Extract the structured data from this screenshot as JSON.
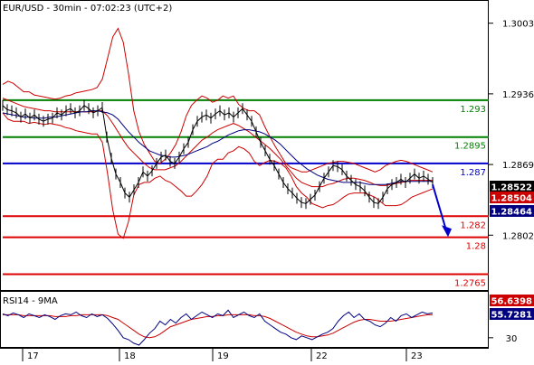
{
  "chart_data": {
    "type": "line",
    "title": "EUR/USD - 30min - 07:02:23 (UTC+2)",
    "xlabel": "",
    "ylabel": "",
    "x_ticks": [
      "17",
      "18",
      "19",
      "22",
      "23"
    ],
    "ylim": [
      1.275,
      1.3025
    ],
    "y_ticks": [
      "1.3003",
      "1.2936",
      "1.2869",
      "1.2802"
    ],
    "legend": "none",
    "grid": false,
    "price": {
      "name": "EUR/USD",
      "color": "#000000",
      "values": [
        1.2925,
        1.2921,
        1.292,
        1.2918,
        1.2914,
        1.2917,
        1.2913,
        1.2916,
        1.2912,
        1.291,
        1.2912,
        1.2913,
        1.2918,
        1.2916,
        1.292,
        1.2922,
        1.2918,
        1.292,
        1.2925,
        1.2922,
        1.2918,
        1.292,
        1.2923,
        1.2895,
        1.2875,
        1.286,
        1.2852,
        1.2842,
        1.2838,
        1.2845,
        1.2852,
        1.2862,
        1.2858,
        1.2863,
        1.287,
        1.2876,
        1.2878,
        1.2872,
        1.287,
        1.2876,
        1.2884,
        1.289,
        1.2902,
        1.291,
        1.2914,
        1.2916,
        1.2913,
        1.2917,
        1.292,
        1.2916,
        1.2918,
        1.2914,
        1.2918,
        1.2922,
        1.2916,
        1.291,
        1.29,
        1.289,
        1.2882,
        1.2874,
        1.2868,
        1.286,
        1.2852,
        1.2846,
        1.2842,
        1.2837,
        1.2833,
        1.2832,
        1.2836,
        1.284,
        1.2848,
        1.2856,
        1.2862,
        1.2868,
        1.2867,
        1.2864,
        1.2858,
        1.2854,
        1.285,
        1.2848,
        1.2844,
        1.2838,
        1.2833,
        1.2832,
        1.2838,
        1.2846,
        1.285,
        1.2852,
        1.2855,
        1.2852,
        1.2856,
        1.286,
        1.2856,
        1.2858,
        1.2855,
        1.2852
      ]
    },
    "bollinger": {
      "name": "Bollinger Bands",
      "color": "#cc0000",
      "upper": [
        1.2945,
        1.2948,
        1.2946,
        1.2942,
        1.2938,
        1.2938,
        1.2935,
        1.2934,
        1.2933,
        1.2932,
        1.2931,
        1.2932,
        1.2934,
        1.2935,
        1.2937,
        1.2938,
        1.2939,
        1.294,
        1.2942,
        1.295,
        1.297,
        1.299,
        1.2998,
        1.2985,
        1.2955,
        1.292,
        1.29,
        1.2888,
        1.288,
        1.2872,
        1.287,
        1.2874,
        1.288,
        1.2888,
        1.29,
        1.2915,
        1.2925,
        1.293,
        1.2934,
        1.2932,
        1.2928,
        1.293,
        1.2934,
        1.2932,
        1.2934,
        1.2926,
        1.2922,
        1.292,
        1.292,
        1.2916,
        1.2905,
        1.2895,
        1.2886,
        1.2878,
        1.287,
        1.2866,
        1.2864,
        1.2862,
        1.2862,
        1.2864,
        1.2866,
        1.2868,
        1.287,
        1.2871,
        1.2872,
        1.2872,
        1.2871,
        1.287,
        1.2868,
        1.2866,
        1.2864,
        1.2862,
        1.2864,
        1.2868,
        1.287,
        1.2872,
        1.2873,
        1.2872,
        1.287,
        1.2868,
        1.2866,
        1.2864,
        1.2862
      ],
      "middle": [
        1.2932,
        1.293,
        1.2928,
        1.2926,
        1.2924,
        1.2923,
        1.2922,
        1.2921,
        1.292,
        1.292,
        1.2919,
        1.2919,
        1.2919,
        1.2919,
        1.2919,
        1.2919,
        1.2919,
        1.2919,
        1.292,
        1.292,
        1.2915,
        1.2908,
        1.29,
        1.2892,
        1.2885,
        1.288,
        1.2875,
        1.287,
        1.2866,
        1.2864,
        1.2864,
        1.2864,
        1.2866,
        1.2868,
        1.2872,
        1.2877,
        1.2882,
        1.2887,
        1.2892,
        1.2895,
        1.2899,
        1.2902,
        1.2904,
        1.2906,
        1.2908,
        1.2906,
        1.2903,
        1.29,
        1.2896,
        1.2892,
        1.2888,
        1.2884,
        1.2879,
        1.2874,
        1.2868,
        1.2862,
        1.2856,
        1.2852,
        1.285,
        1.2848,
        1.2848,
        1.2848,
        1.285,
        1.2851,
        1.2853,
        1.2855,
        1.2856,
        1.2856,
        1.2855,
        1.2854,
        1.2852,
        1.285,
        1.2849,
        1.2849,
        1.285,
        1.2851,
        1.2852,
        1.2853,
        1.2854,
        1.2854,
        1.2854,
        1.2854,
        1.2854
      ],
      "lower": [
        1.2918,
        1.2912,
        1.291,
        1.291,
        1.291,
        1.2908,
        1.2909,
        1.2908,
        1.2907,
        1.2908,
        1.2907,
        1.2906,
        1.2904,
        1.2903,
        1.2901,
        1.29,
        1.2899,
        1.2898,
        1.2898,
        1.289,
        1.286,
        1.2826,
        1.2803,
        1.2799,
        1.2815,
        1.284,
        1.285,
        1.2852,
        1.2852,
        1.2856,
        1.2858,
        1.2854,
        1.2852,
        1.2848,
        1.2844,
        1.2839,
        1.2839,
        1.2844,
        1.285,
        1.2858,
        1.287,
        1.2874,
        1.2874,
        1.288,
        1.2882,
        1.2886,
        1.2884,
        1.288,
        1.2872,
        1.2868,
        1.2871,
        1.2873,
        1.2872,
        1.287,
        1.2866,
        1.2858,
        1.2848,
        1.2842,
        1.2838,
        1.2832,
        1.283,
        1.2828,
        1.283,
        1.2831,
        1.2834,
        1.2838,
        1.2841,
        1.2842,
        1.2842,
        1.2842,
        1.284,
        1.2838,
        1.2834,
        1.283,
        1.283,
        1.283,
        1.2831,
        1.2834,
        1.2838,
        1.284,
        1.2842,
        1.2844,
        1.2846
      ]
    },
    "moving_average": {
      "name": "Moving Average",
      "color": "#000080",
      "values": [
        1.2918,
        1.2917,
        1.2916,
        1.2915,
        1.2914,
        1.2914,
        1.2913,
        1.2913,
        1.2913,
        1.2914,
        1.2914,
        1.2915,
        1.2916,
        1.2917,
        1.2918,
        1.2919,
        1.2919,
        1.292,
        1.292,
        1.2919,
        1.2918,
        1.2916,
        1.2912,
        1.2906,
        1.29,
        1.2895,
        1.289,
        1.2886,
        1.2882,
        1.288,
        1.2878,
        1.2877,
        1.2876,
        1.2876,
        1.2877,
        1.2878,
        1.288,
        1.2882,
        1.2884,
        1.2886,
        1.2889,
        1.2891,
        1.2894,
        1.2897,
        1.2899,
        1.2901,
        1.2902,
        1.2902,
        1.2901,
        1.29,
        1.2898,
        1.2895,
        1.2892,
        1.2888,
        1.2883,
        1.2878,
        1.2873,
        1.2869,
        1.2865,
        1.2862,
        1.2859,
        1.2857,
        1.2855,
        1.2854,
        1.2853,
        1.2852,
        1.2852,
        1.2852,
        1.2852,
        1.2851,
        1.285,
        1.285,
        1.285,
        1.285,
        1.2851,
        1.2852,
        1.2853,
        1.2853,
        1.2853,
        1.2853,
        1.2853,
        1.2853,
        1.2853
      ]
    },
    "levels": [
      {
        "value": 1.293,
        "label": "1.293",
        "color": "#008000"
      },
      {
        "value": 1.2895,
        "label": "1.2895",
        "color": "#008000"
      },
      {
        "value": 1.287,
        "label": "1.287",
        "color": "#0000cc"
      },
      {
        "value": 1.282,
        "label": "1.282",
        "color": "#dd0000"
      },
      {
        "value": 1.28,
        "label": "1.28",
        "color": "#dd0000"
      },
      {
        "value": 1.2765,
        "label": "1.2765",
        "color": "#dd0000"
      }
    ],
    "price_badges": [
      {
        "label": "1.28522",
        "color": "#000000"
      },
      {
        "label": "1.28504",
        "color": "#cc0000"
      },
      {
        "label": "1.28464",
        "color": "#000080"
      }
    ],
    "forecast_arrow": {
      "from": 1.285,
      "to": 1.2802,
      "color": "#0000cc"
    },
    "rsi": {
      "title": "RSI14 - 9MA",
      "ylim": [
        20,
        80
      ],
      "y_ticks": [
        "30"
      ],
      "rsi_values": [
        56,
        54,
        57,
        55,
        52,
        56,
        54,
        52,
        55,
        53,
        50,
        54,
        56,
        55,
        58,
        54,
        52,
        56,
        53,
        55,
        51,
        45,
        38,
        30,
        28,
        24,
        22,
        28,
        35,
        40,
        48,
        44,
        50,
        46,
        52,
        56,
        50,
        54,
        58,
        55,
        52,
        56,
        54,
        60,
        52,
        55,
        58,
        54,
        52,
        56,
        48,
        44,
        40,
        36,
        34,
        30,
        28,
        32,
        30,
        28,
        31,
        34,
        36,
        40,
        48,
        54,
        58,
        52,
        56,
        50,
        48,
        44,
        42,
        46,
        52,
        48,
        54,
        56,
        52,
        55,
        58,
        56,
        57
      ],
      "ma_values": [
        55,
        55,
        55,
        55,
        54,
        54,
        54,
        54,
        54,
        54,
        53,
        53,
        53,
        54,
        54,
        55,
        55,
        55,
        55,
        55,
        54,
        52,
        50,
        46,
        42,
        38,
        34,
        31,
        30,
        31,
        34,
        38,
        42,
        44,
        46,
        48,
        50,
        51,
        52,
        53,
        53,
        54,
        54,
        55,
        55,
        55,
        55,
        55,
        54,
        54,
        53,
        51,
        48,
        45,
        42,
        39,
        36,
        34,
        32,
        31,
        31,
        32,
        33,
        35,
        38,
        41,
        44,
        47,
        49,
        50,
        50,
        49,
        48,
        48,
        48,
        49,
        50,
        51,
        52,
        53,
        54,
        55,
        55
      ],
      "rsi_color": "#000080",
      "ma_color": "#cc0000",
      "badges": [
        {
          "label": "56.6398",
          "color": "#cc0000"
        },
        {
          "label": "55.7281",
          "color": "#000080"
        }
      ]
    }
  }
}
